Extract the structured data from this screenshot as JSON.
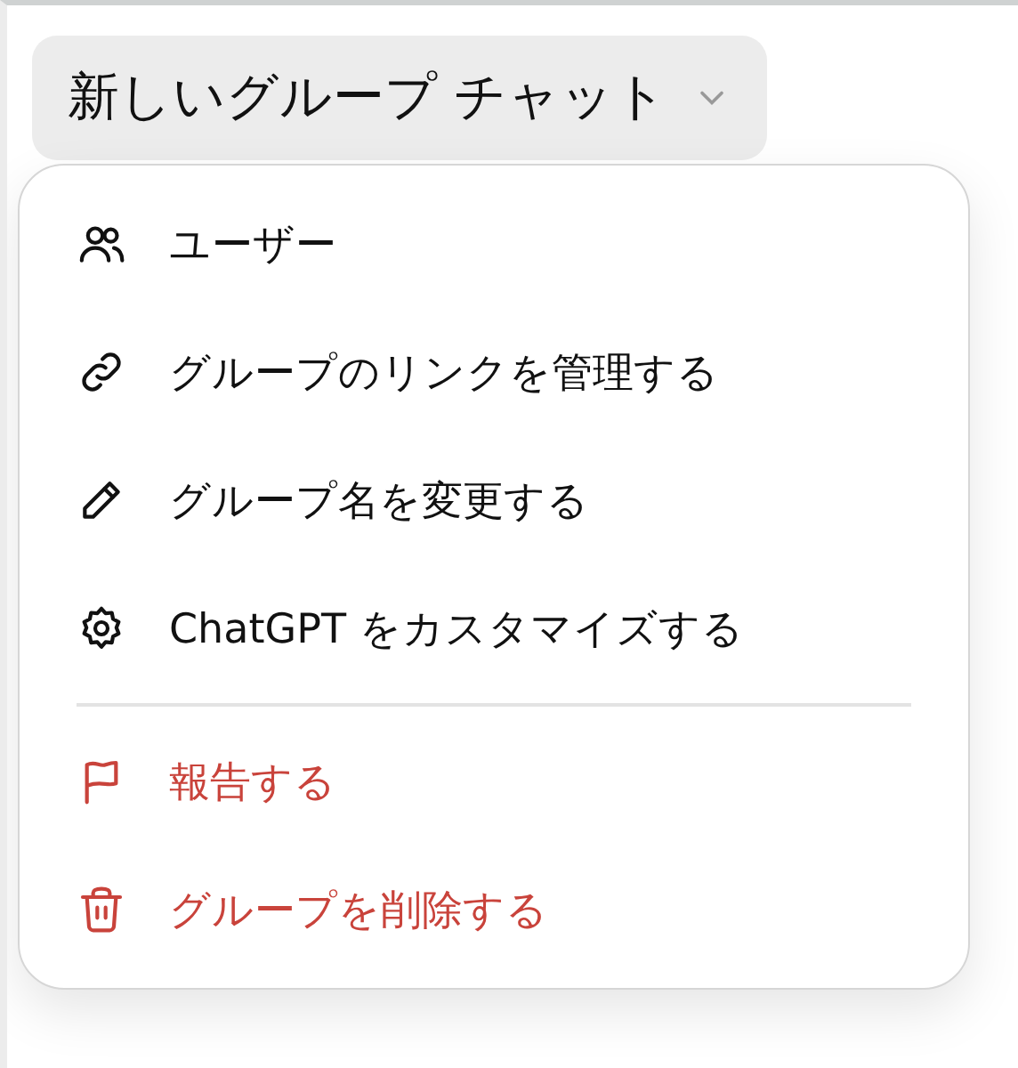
{
  "title_button": {
    "label": "新しいグループ チャット",
    "expanded": true
  },
  "menu": {
    "groups": [
      [
        {
          "label": "ユーザー",
          "kind": "normal"
        },
        {
          "label": "グループのリンクを管理する",
          "kind": "normal"
        },
        {
          "label": "グループ名を変更する",
          "kind": "normal"
        },
        {
          "label": "ChatGPT をカスタマイズする",
          "kind": "normal"
        }
      ],
      [
        {
          "label": "報告する",
          "kind": "danger"
        },
        {
          "label": "グループを削除する",
          "kind": "danger"
        }
      ]
    ]
  }
}
